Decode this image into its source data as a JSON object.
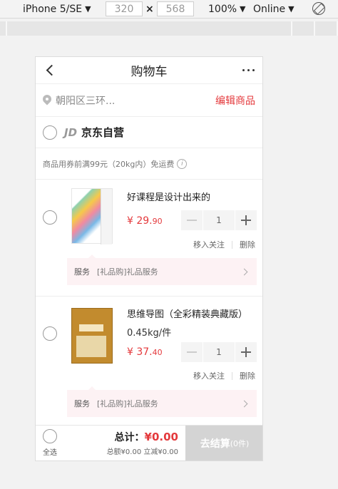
{
  "devtools": {
    "device": "iPhone 5/SE",
    "width": "320",
    "times": "×",
    "height": "568",
    "zoom": "100%",
    "network": "Online"
  },
  "header": {
    "title": "购物车"
  },
  "address": {
    "text": "朝阳区三环...",
    "edit_label": "编辑商品"
  },
  "shop": {
    "logo": "JD",
    "name": "京东自营"
  },
  "notice": {
    "text": "商品用券前满99元（20kg内）免运费",
    "info_glyph": "i"
  },
  "items": [
    {
      "name": "好课程是设计出来的",
      "spec": "",
      "price_main": "¥ 29.",
      "price_cents": "90",
      "quantity": "1",
      "move_label": "移入关注",
      "delete_label": "删除",
      "service_label": "服务",
      "service_text": "[礼品购]礼品服务"
    },
    {
      "name": "思维导图（全彩精装典藏版）",
      "spec": "0.45kg/件",
      "price_main": "¥ 37.",
      "price_cents": "40",
      "quantity": "1",
      "move_label": "移入关注",
      "delete_label": "删除",
      "service_label": "服务",
      "service_text": "[礼品购]礼品服务"
    }
  ],
  "footer": {
    "select_all_label": "全选",
    "total_label": "总计：",
    "total_amount": "¥0.00",
    "sub_text": "总额¥0.00 立减¥0.00",
    "checkout_label": "去结算",
    "checkout_count": "(0件)"
  },
  "colors": {
    "accent": "#e4393c",
    "checkout_disabled": "#d4d4d4"
  }
}
